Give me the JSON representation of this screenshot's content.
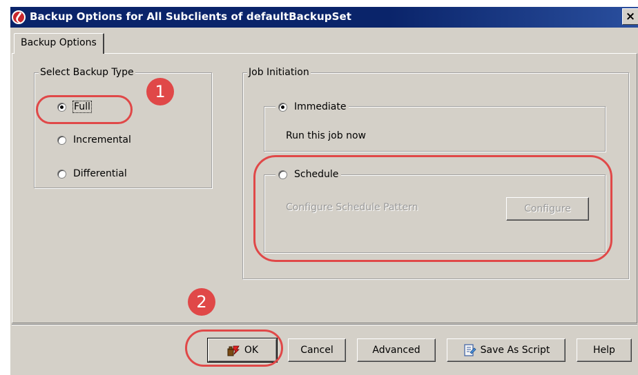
{
  "window": {
    "title": "Backup Options for All Subclients of defaultBackupSet",
    "close_glyph": "×",
    "app_icon": "commvault-logo-icon"
  },
  "tabs": [
    {
      "label": "Backup Options",
      "selected": true
    }
  ],
  "backup_type": {
    "legend": "Select Backup Type",
    "options": [
      {
        "label": "Full",
        "selected": true
      },
      {
        "label": "Incremental",
        "selected": false
      },
      {
        "label": "Differential",
        "selected": false
      }
    ]
  },
  "job_initiation": {
    "legend": "Job Initiation",
    "immediate": {
      "label": "Immediate",
      "selected": true,
      "description": "Run this job now"
    },
    "schedule": {
      "label": "Schedule",
      "selected": false,
      "description": "Configure Schedule Pattern",
      "configure_label": "Configure",
      "enabled": false
    }
  },
  "footer": {
    "ok_label": "OK",
    "cancel_label": "Cancel",
    "advanced_label": "Advanced",
    "save_script_label": "Save As Script",
    "help_label": "Help"
  },
  "annotations": {
    "step1": "1",
    "step2": "2",
    "color": "#e04848"
  }
}
